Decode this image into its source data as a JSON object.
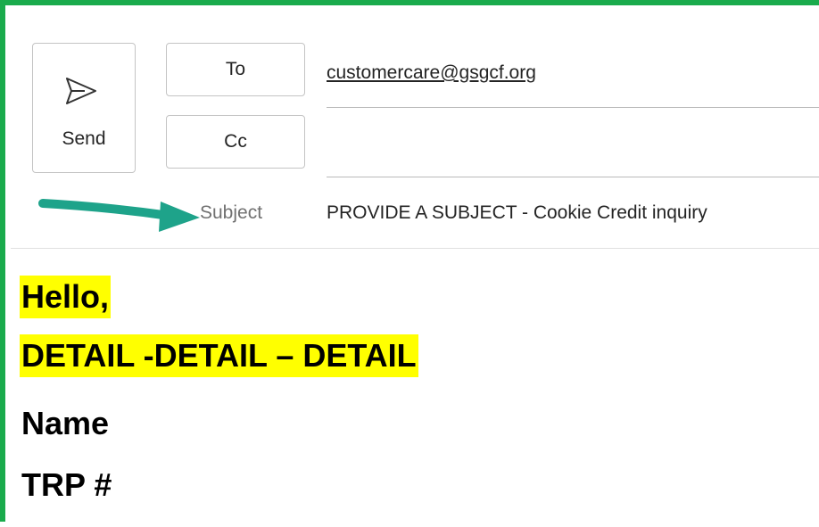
{
  "compose": {
    "send_label": "Send",
    "to_label": "To",
    "cc_label": "Cc",
    "to_value": "customercare@gsgcf.org",
    "cc_value": "",
    "subject_label": "Subject",
    "subject_value": "PROVIDE A SUBJECT - Cookie Credit inquiry"
  },
  "body": {
    "lines": [
      "Hello,",
      "DETAIL -DETAIL – DETAIL",
      "Name",
      "TRP #"
    ],
    "highlight_color": "#ffff00"
  },
  "colors": {
    "frame": "#1aab4c",
    "arrow": "#1ea38a"
  },
  "icons": {
    "send": "send-icon",
    "annotation": "arrow-annotation-icon"
  }
}
